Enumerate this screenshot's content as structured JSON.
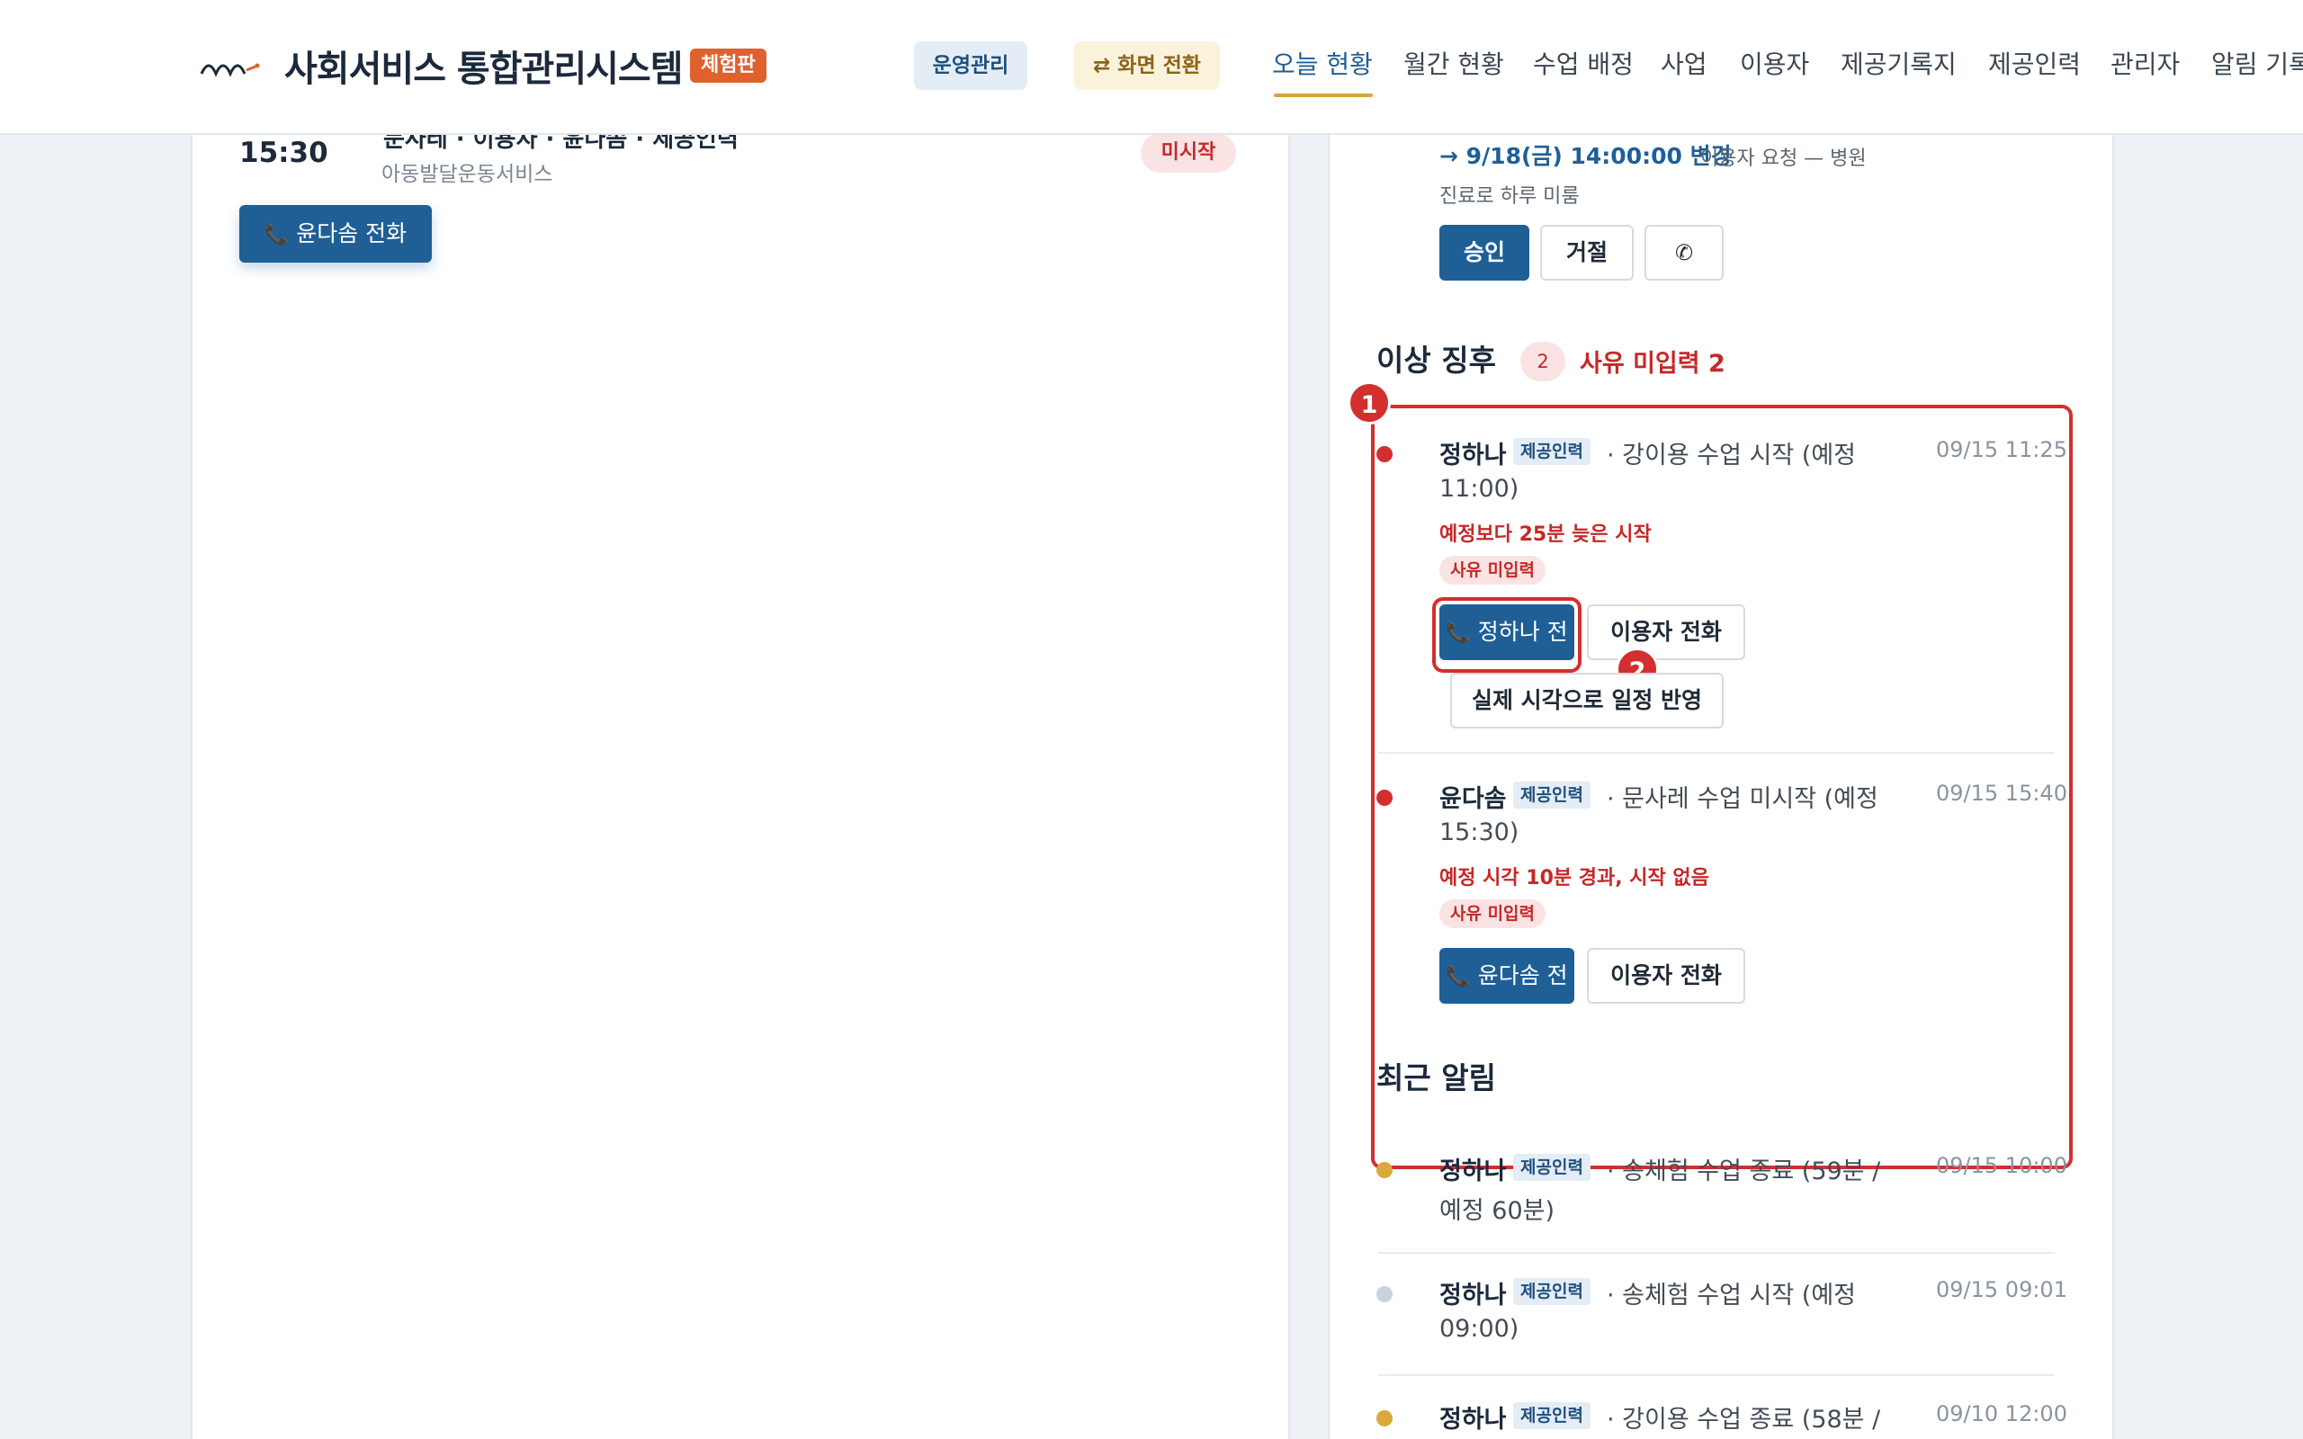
{
  "header": {
    "brand": "사회서비스 통합관리시스템",
    "trial_badge": "체험판",
    "ops_button": "운영관리",
    "switch_button": "⇄ 화면 전환",
    "nav": [
      "오늘 현황",
      "월간 현황",
      "수업 배정",
      "사업",
      "이용자",
      "제공기록지",
      "제공인력",
      "관리자",
      "알림 기록"
    ]
  },
  "left": {
    "session": {
      "time": "15:30",
      "title_partial": "문사레 · 이용자 · 윤다솜 · 제공인력",
      "service": "아동발달운동서비스",
      "status": "미시작",
      "call_button": "윤다솜 전화"
    }
  },
  "right": {
    "request": {
      "change_text": "→ 9/18(금) 14:00:00 변경",
      "reason_line1": "이용자 요청 — 병원",
      "reason_line2": "진료로 하루 미룸",
      "approve": "승인",
      "reject": "거절"
    },
    "anomalies": {
      "title": "이상 징후",
      "count": "2",
      "missing_reason": "사유 미입력 2",
      "items": [
        {
          "name": "정하나",
          "role": "제공인력",
          "desc_line1": "· 강이용 수업 시작 (예정",
          "desc_line2": "11:00)",
          "time": "09/15 11:25",
          "warning": "예정보다 25분 늦은 시작",
          "reason_tag": "사유 미입력",
          "call_provider": "정하나 전화",
          "call_user": "이용자 전화",
          "apply_button": "실제 시각으로 일정 반영"
        },
        {
          "name": "윤다솜",
          "role": "제공인력",
          "desc_line1": "· 문사레 수업 미시작 (예정",
          "desc_line2": "15:30)",
          "time": "09/15 15:40",
          "warning": "예정 시각 10분 경과, 시작 없음",
          "reason_tag": "사유 미입력",
          "call_provider": "윤다솜 전화",
          "call_user": "이용자 전화"
        }
      ]
    },
    "recent": {
      "title": "최근 알림",
      "items": [
        {
          "name": "정하나",
          "role": "제공인력",
          "desc_line1": "· 송체험 수업 종료 (59분 /",
          "desc_line2": "예정 60분)",
          "time": "09/15 10:00",
          "dot_color": "#d9a93c"
        },
        {
          "name": "정하나",
          "role": "제공인력",
          "desc_line1": "· 송체험 수업 시작 (예정",
          "desc_line2": "09:00)",
          "time": "09/15 09:01",
          "dot_color": "#c8d3df"
        },
        {
          "name": "정하나",
          "role": "제공인력",
          "desc_line1": "· 강이용 수업 종료 (58분 /",
          "desc_line2": "",
          "time": "09/10 12:00",
          "dot_color": "#d9a93c"
        }
      ]
    }
  },
  "annotations": [
    "1",
    "2"
  ],
  "colors": {
    "primary": "#1f5f96",
    "alert": "#d32f2f",
    "accent": "#d6a63c"
  }
}
